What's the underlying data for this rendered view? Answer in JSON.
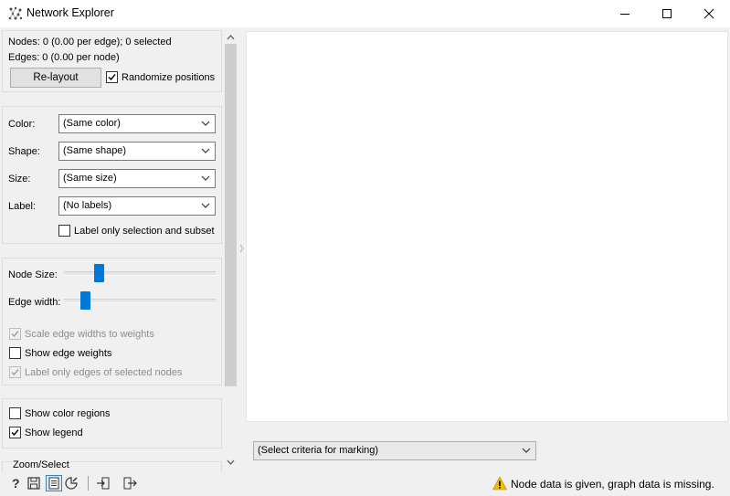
{
  "window": {
    "title": "Network Explorer",
    "app_icon": "network-graph-icon",
    "controls": [
      "minimize-icon",
      "maximize-icon",
      "close-icon"
    ]
  },
  "info": {
    "nodes_text": "Nodes: 0 (0.00 per edge); 0 selected",
    "edges_text": "Edges: 0 (0.00 per node)",
    "relayout_label": "Re-layout",
    "randomize_label": "Randomize positions",
    "randomize_checked": true
  },
  "attributes": {
    "color_label": "Color:",
    "color_value": "(Same color)",
    "shape_label": "Shape:",
    "shape_value": "(Same shape)",
    "size_label": "Size:",
    "size_value": "(Same size)",
    "label_label": "Label:",
    "label_value": "(No labels)",
    "label_only_selection_label": "Label only selection and subset",
    "label_only_selection_checked": false
  },
  "sizes": {
    "node_size_label": "Node Size:",
    "node_size_fraction": 0.22,
    "edge_width_label": "Edge width:",
    "edge_width_fraction": 0.13,
    "scale_edge_label": "Scale edge widths to weights",
    "scale_edge_checked": true,
    "scale_edge_enabled": false,
    "show_edge_weights_label": "Show edge weights",
    "show_edge_weights_checked": false,
    "label_selected_edges_label": "Label only edges of selected nodes",
    "label_selected_edges_checked": true,
    "label_selected_edges_enabled": false
  },
  "display": {
    "show_color_regions_label": "Show color regions",
    "show_color_regions_checked": false,
    "show_legend_label": "Show legend",
    "show_legend_checked": true
  },
  "zoom_select_label": "Zoom/Select",
  "marking": {
    "criteria_value": "(Select criteria for marking)"
  },
  "status": {
    "icons": [
      "help-icon",
      "save-icon",
      "report-icon",
      "visual-settings-icon",
      "input-icon",
      "output-icon"
    ],
    "warning_text": "Node data is given, graph data is missing.",
    "colors": {
      "accent": "#0078d7",
      "warning": "#f0c000"
    }
  }
}
